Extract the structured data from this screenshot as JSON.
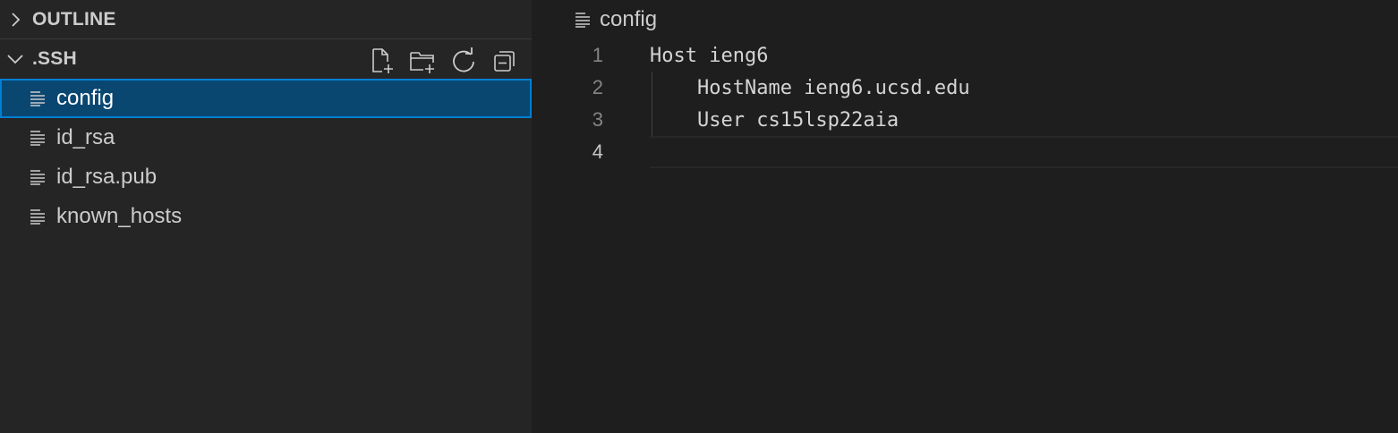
{
  "sidebar": {
    "outline": {
      "title": "OUTLINE",
      "icon": "chevron-right-icon"
    },
    "folder": {
      "title": ".SSH",
      "icon": "chevron-down-icon",
      "actions": [
        {
          "name": "new-file-button",
          "icon": "new-file-icon"
        },
        {
          "name": "new-folder-button",
          "icon": "new-folder-icon"
        },
        {
          "name": "refresh-button",
          "icon": "refresh-icon"
        },
        {
          "name": "collapse-all-button",
          "icon": "collapse-all-icon"
        }
      ],
      "files": [
        {
          "label": "config",
          "selected": true
        },
        {
          "label": "id_rsa",
          "selected": false
        },
        {
          "label": "id_rsa.pub",
          "selected": false
        },
        {
          "label": "known_hosts",
          "selected": false
        }
      ]
    }
  },
  "editor": {
    "breadcrumb": "config",
    "lines": [
      {
        "number": "1",
        "text": "Host ieng6"
      },
      {
        "number": "2",
        "text": "    HostName ieng6.ucsd.edu"
      },
      {
        "number": "3",
        "text": "    User cs15lsp22aia"
      },
      {
        "number": "4",
        "text": ""
      }
    ],
    "active_line": "4"
  },
  "colors": {
    "selection_bg": "#094771",
    "selection_border": "#007fd4",
    "sidebar_bg": "#252526",
    "editor_bg": "#1e1e1e"
  }
}
